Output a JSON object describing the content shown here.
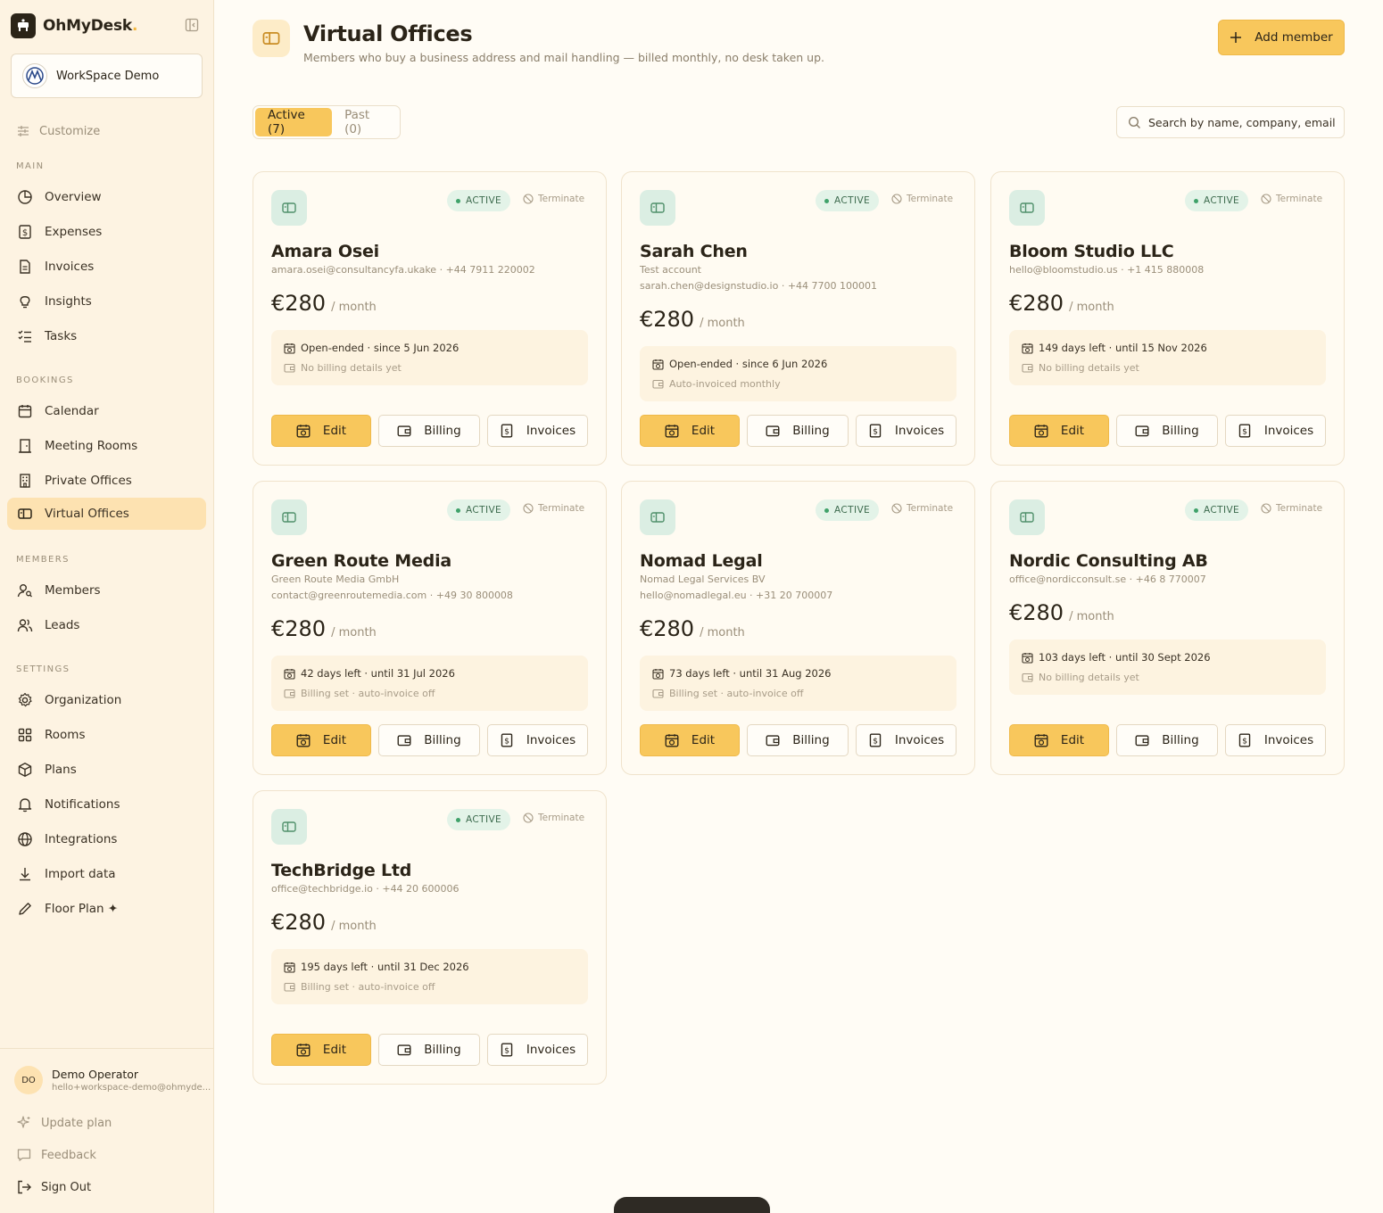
{
  "sidebar": {
    "brand": "OhMyDesk",
    "brand_dot": ".",
    "workspace": "WorkSpace Demo",
    "customize": "Customize",
    "sections": {
      "main": "MAIN",
      "bookings": "BOOKINGS",
      "members": "MEMBERS",
      "settings": "SETTINGS"
    },
    "nav": {
      "overview": "Overview",
      "expenses": "Expenses",
      "invoices": "Invoices",
      "insights": "Insights",
      "tasks": "Tasks",
      "calendar": "Calendar",
      "meeting_rooms": "Meeting Rooms",
      "private_offices": "Private Offices",
      "virtual_offices": "Virtual Offices",
      "members": "Members",
      "leads": "Leads",
      "organization": "Organization",
      "rooms": "Rooms",
      "plans": "Plans",
      "notifications": "Notifications",
      "integrations": "Integrations",
      "import_data": "Import data",
      "floor_plan": "Floor Plan ✦"
    },
    "user": {
      "initials": "DO",
      "name": "Demo Operator",
      "email": "hello+workspace-demo@ohmyde..."
    },
    "update_plan": "Update plan",
    "feedback": "Feedback",
    "sign_out": "Sign Out"
  },
  "header": {
    "title": "Virtual Offices",
    "subtitle": "Members who buy a business address and mail handling — billed monthly, no desk taken up.",
    "add_button": "Add member"
  },
  "tabs": {
    "active": "Active (7)",
    "past": "Past (0)"
  },
  "search": {
    "placeholder": "Search by name, company, email..."
  },
  "card_labels": {
    "status": "ACTIVE",
    "terminate": "Terminate",
    "per": "/ month",
    "edit": "Edit",
    "billing": "Billing",
    "invoices": "Invoices"
  },
  "cards": [
    {
      "name": "Amara Osei",
      "line1": "amara.osei@consultancyfa.ukake · +44 7911 220002",
      "line2": "",
      "price": "€280",
      "term": "Open-ended",
      "term_detail": " · since 5 Jun 2026",
      "billing": "No billing details yet"
    },
    {
      "name": "Sarah Chen",
      "line1": "Test account",
      "line2": "sarah.chen@designstudio.io · +44 7700 100001",
      "price": "€280",
      "term": "Open-ended",
      "term_detail": " · since 6 Jun 2026",
      "billing": "Auto-invoiced monthly"
    },
    {
      "name": "Bloom Studio LLC",
      "line1": "hello@bloomstudio.us · +1 415 880008",
      "line2": "",
      "price": "€280",
      "term": "149 days left",
      "term_detail": " · until 15 Nov 2026",
      "billing": "No billing details yet"
    },
    {
      "name": "Green Route Media",
      "line1": "Green Route Media GmbH",
      "line2": "contact@greenroutemedia.com · +49 30 800008",
      "price": "€280",
      "term": "42 days left",
      "term_detail": " · until 31 Jul 2026",
      "billing": "Billing set · auto-invoice off"
    },
    {
      "name": "Nomad Legal",
      "line1": "Nomad Legal Services BV",
      "line2": "hello@nomadlegal.eu · +31 20 700007",
      "price": "€280",
      "term": "73 days left",
      "term_detail": " · until 31 Aug 2026",
      "billing": "Billing set · auto-invoice off"
    },
    {
      "name": "Nordic Consulting AB",
      "line1": "office@nordicconsult.se · +46 8 770007",
      "line2": "",
      "price": "€280",
      "term": "103 days left",
      "term_detail": " · until 30 Sept 2026",
      "billing": "No billing details yet"
    },
    {
      "name": "TechBridge Ltd",
      "line1": "office@techbridge.io · +44 20 600006",
      "line2": "",
      "price": "€280",
      "term": "195 days left",
      "term_detail": " · until 31 Dec 2026",
      "billing": "Billing set · auto-invoice off"
    }
  ]
}
